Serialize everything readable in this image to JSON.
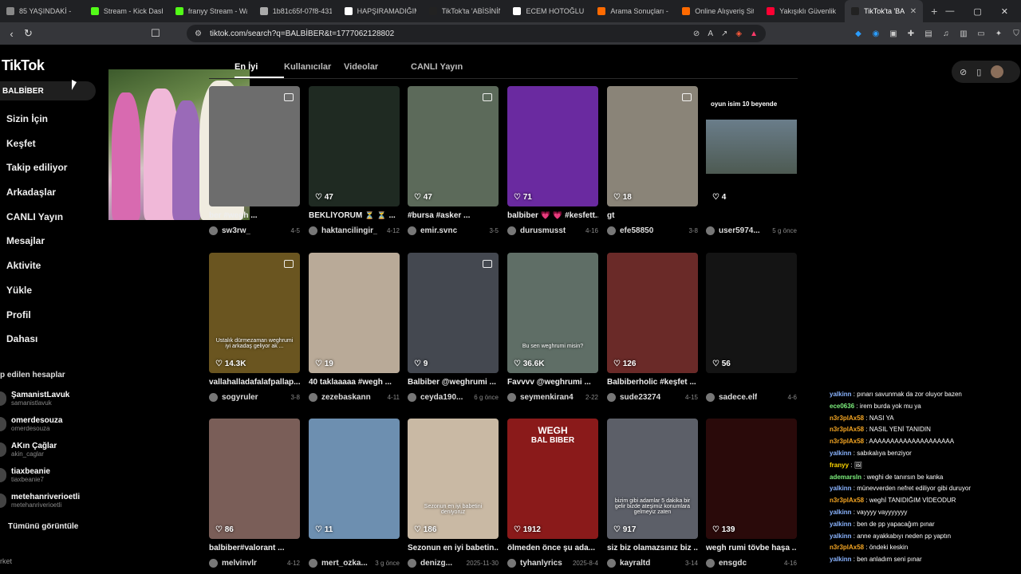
{
  "browser": {
    "tabs": [
      {
        "title": "85 YAŞINDAKİ - ",
        "color": "#888"
      },
      {
        "title": "Stream - Kick Dashb",
        "color": "#53fc18"
      },
      {
        "title": "franyy Stream - Wa",
        "color": "#53fc18"
      },
      {
        "title": "1b81c65f-07f8-431",
        "color": "#aaaaaa"
      },
      {
        "title": "HAPŞIRAMADIĞIM",
        "color": "#ffffff"
      },
      {
        "title": "TikTok'ta 'ABİSİNİN",
        "color": "#222"
      },
      {
        "title": "ECEM HOTOĞLU - G",
        "color": "#ffffff"
      },
      {
        "title": "Arama Sonuçları - T",
        "color": "#ff6a00"
      },
      {
        "title": "Online Alışveriş Site",
        "color": "#ff6a00"
      },
      {
        "title": "Yakışıklı Güvenlik M",
        "color": "#ff0033"
      },
      {
        "title": "TikTok'ta 'BA",
        "color": "#222",
        "active": true
      }
    ],
    "close_tab": "✕",
    "new_tab": "+",
    "url": "tiktok.com/search?q=BALBİBER&t=1777062128802",
    "window_controls": [
      "—",
      "▢",
      "✕"
    ]
  },
  "tiktok": {
    "logo": "TikTok",
    "search_value": "BALBİBER",
    "nav": [
      "Sizin İçin",
      "Keşfet",
      "Takip ediliyor",
      "Arkadaşlar",
      "CANLI Yayın",
      "Mesajlar",
      "Aktivite",
      "Yükle",
      "Profil",
      "Dahası"
    ],
    "followed_title": "p edilen hesaplar",
    "followed": [
      {
        "name": "ŞamanistLavuk",
        "handle": "samanistlavuk"
      },
      {
        "name": "omerdesouza",
        "handle": "omerdesouza"
      },
      {
        "name": "AKın Çağlar",
        "handle": "akin_caglar"
      },
      {
        "name": "tiaxbeanie",
        "handle": "tiaxbeanie7"
      },
      {
        "name": "metehanriverioetli",
        "handle": "metehanriverioetli"
      }
    ],
    "see_all": "Tümünü görüntüle",
    "footer": "rket",
    "search_tabs": [
      "En İyi",
      "Kullanıcılar",
      "Videolar",
      "CANLI Yayın"
    ]
  },
  "videos": [
    {
      "likes": "",
      "desc": "ber #wegh ...",
      "user": "sw3rw_",
      "date": "4-5",
      "bg": "#6d6d6d",
      "multi": true
    },
    {
      "likes": "47",
      "desc": "BEKLİYORUM ⏳ ⏳ ...",
      "user": "haktancilingir_",
      "date": "4-12",
      "bg": "#1f2a22",
      "multi": false
    },
    {
      "likes": "47",
      "desc": "#bursa #asker ...",
      "user": "emir.svnc",
      "date": "3-5",
      "bg": "#5c6a5a",
      "multi": true
    },
    {
      "likes": "71",
      "desc": "balbiber 💗 💗 #kesfett...",
      "user": "durusmusst",
      "date": "4-16",
      "bg": "#6a2aa0",
      "multi": false
    },
    {
      "likes": "18",
      "desc": "gt",
      "user": "efe58850",
      "date": "3-8",
      "bg": "#8a8478",
      "multi": true
    },
    {
      "likes": "4",
      "desc": "",
      "user": "user5974...",
      "date": "5 g önce",
      "bg": "#000",
      "multi": false
    },
    {
      "likes": "14.3K",
      "desc": "vallahalladafalafpallap...",
      "user": "sogyruler",
      "date": "3-8",
      "bg": "#6a5520",
      "multi": true
    },
    {
      "likes": "19",
      "desc": "40 taklaaaaa #wegh ...",
      "user": "zezebaskann",
      "date": "4-11",
      "bg": "#b9aa98",
      "multi": false
    },
    {
      "likes": "9",
      "desc": "Balbiber @weghrumi ...",
      "user": "ceyda190...",
      "date": "6 g önce",
      "bg": "#444850",
      "multi": true
    },
    {
      "likes": "36.6K",
      "desc": "Favvvv @weghrumi ...",
      "user": "seymenkiran4",
      "date": "2-22",
      "bg": "#5f6e66",
      "multi": false
    },
    {
      "likes": "126",
      "desc": "Balbiberholic #keşfet ...",
      "user": "sude23274",
      "date": "4-15",
      "bg": "#6a2a28",
      "multi": false
    },
    {
      "likes": "56",
      "desc": "",
      "user": "sadece.elf",
      "date": "4-6",
      "bg": "#141414",
      "multi": false
    },
    {
      "likes": "86",
      "desc": "balbiber#valorant ...",
      "user": "melvinvlr",
      "date": "4-12",
      "bg": "#7a5e58",
      "multi": false
    },
    {
      "likes": "11",
      "desc": "",
      "user": "mert_ozka...",
      "date": "3 g önce",
      "bg": "#6d8fb0",
      "multi": false
    },
    {
      "likes": "186",
      "desc": "Sezonun en iyi babetin...",
      "user": "denizg...",
      "date": "2025-11-30",
      "bg": "#c9b9a4",
      "multi": false
    },
    {
      "likes": "1912",
      "desc": "ölmeden önce şu ada...",
      "user": "tyhanlyrics",
      "date": "2025-8-4",
      "bg": "#8a1a1a",
      "multi": false
    },
    {
      "likes": "917",
      "desc": "siz biz olamazsınız biz ...",
      "user": "kayraltd",
      "date": "3-14",
      "bg": "#5c5f68",
      "multi": false
    },
    {
      "likes": "139",
      "desc": "wegh rumi tövbe haşa ...",
      "user": "ensgdc",
      "date": "4-16",
      "bg": "#2a0a0a",
      "multi": false
    }
  ],
  "overlays": {
    "card5_title": "oyun isim 10 beyende",
    "card6": "Ustalık dürmezaman weghrumi iyi arkadaş geliyor ak ...",
    "card9": "Bu sen weghrumi misin?",
    "card14": "Sezonun en iyi babetini deniyoruz",
    "card15_top": "WEGH",
    "card15_bottom": "BAL BIBER",
    "card16": "bizim gibi adamlar 5 dakika bir gelir bizde ateşimiz konumlara gelmeyiz zaten"
  },
  "chat": [
    {
      "user": "yalkinn",
      "msg": "pınarı savunmak da zor oluyor bazen",
      "color": "#8ab4ff"
    },
    {
      "user": "ece0636",
      "msg": "irem burda yok mu ya",
      "color": "#7df07d"
    },
    {
      "user": "n3r3plAx58",
      "msg": "NASI YA",
      "color": "#f5a623"
    },
    {
      "user": "n3r3plAx58",
      "msg": "NASIL YENİ TANIDIN",
      "color": "#f5a623"
    },
    {
      "user": "n3r3plAx58",
      "msg": "AAAAAAAAAAAAAAAAAAAA",
      "color": "#f5a623"
    },
    {
      "user": "yalkinn",
      "msg": "sabıkalıya benziyor",
      "color": "#8ab4ff"
    },
    {
      "user": "franyy",
      "msg": "🖼",
      "color": "#ffd700"
    },
    {
      "user": "ademarsln",
      "msg": "weghi de tanırsın be kanka",
      "color": "#7df07d"
    },
    {
      "user": "yalkinn",
      "msg": "münevverden nefret ediliyor gibi duruyor",
      "color": "#8ab4ff"
    },
    {
      "user": "n3r3plAx58",
      "msg": "weghİ TANIDIĞIM VİDEODUR",
      "color": "#f5a623"
    },
    {
      "user": "yalkinn",
      "msg": "vayyyy vayyyyyyy",
      "color": "#8ab4ff"
    },
    {
      "user": "yalkinn",
      "msg": "ben de pp yapacağım pınar",
      "color": "#8ab4ff"
    },
    {
      "user": "yalkinn",
      "msg": "anne ayakkabıyı neden pp yaptın",
      "color": "#8ab4ff"
    },
    {
      "user": "n3r3plAx58",
      "msg": "öndeki keskin",
      "color": "#f5a623"
    },
    {
      "user": "yalkinn",
      "msg": "ben anladım seni pınar",
      "color": "#8ab4ff"
    }
  ]
}
